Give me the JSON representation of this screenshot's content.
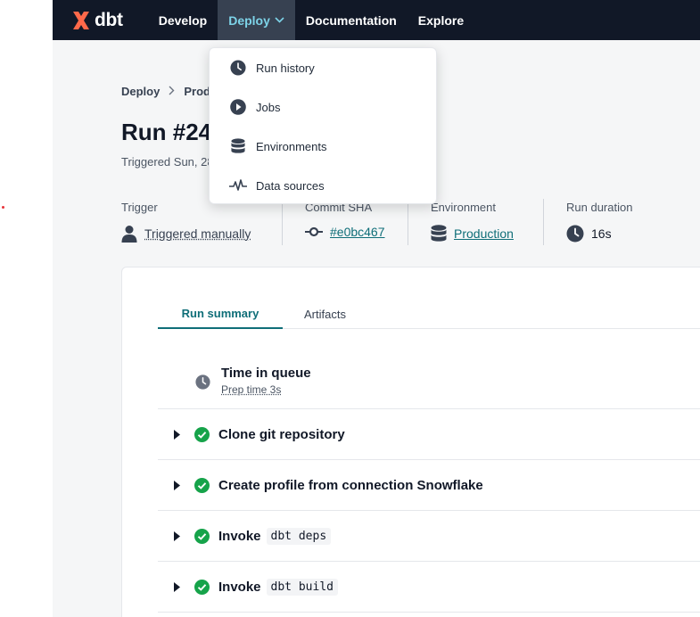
{
  "nav": {
    "brand": "dbt",
    "items": [
      {
        "label": "Develop",
        "active": false
      },
      {
        "label": "Deploy",
        "active": true
      },
      {
        "label": "Documentation",
        "active": false
      },
      {
        "label": "Explore",
        "active": false
      }
    ]
  },
  "dropdown": {
    "items": [
      {
        "label": "Run history",
        "icon": "clock-icon"
      },
      {
        "label": "Jobs",
        "icon": "play-icon"
      },
      {
        "label": "Environments",
        "icon": "database-icon"
      },
      {
        "label": "Data sources",
        "icon": "pulse-icon"
      }
    ]
  },
  "breadcrumb": {
    "items": [
      "Deploy",
      "Prod"
    ]
  },
  "page": {
    "title": "Run #24",
    "subtitle": "Triggered Sun, 28"
  },
  "meta": {
    "trigger": {
      "label": "Trigger",
      "value": "Triggered manually"
    },
    "commit": {
      "label": "Commit SHA",
      "value": "#e0bc467"
    },
    "environment": {
      "label": "Environment",
      "value": "Production"
    },
    "duration": {
      "label": "Run duration",
      "value": "16s"
    }
  },
  "tabs": [
    {
      "label": "Run summary",
      "active": true
    },
    {
      "label": "Artifacts",
      "active": false
    }
  ],
  "queue": {
    "title": "Time in queue",
    "subtitle": "Prep time 3s"
  },
  "steps": [
    {
      "label": "Clone git repository",
      "code": ""
    },
    {
      "label": "Create profile from connection Snowflake",
      "code": ""
    },
    {
      "label": "Invoke",
      "code": "dbt deps"
    },
    {
      "label": "Invoke",
      "code": "dbt build"
    }
  ],
  "colors": {
    "nav_bg": "#111827",
    "accent": "#0f6e78",
    "success": "#16a34a",
    "brand_orange": "#ff694a"
  }
}
